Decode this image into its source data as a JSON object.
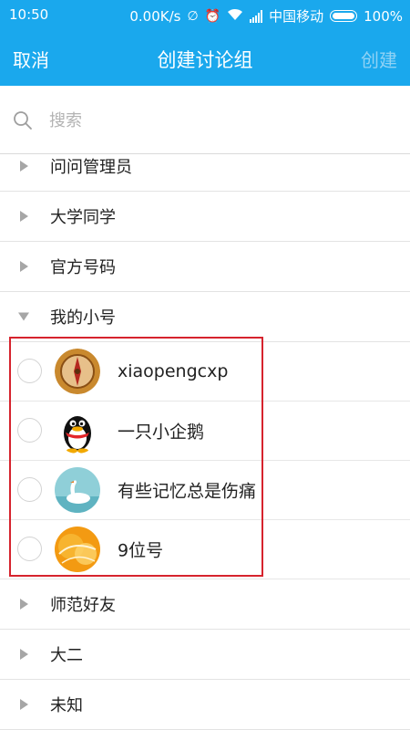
{
  "status_bar": {
    "time": "10:50",
    "speed": "0.00K/s",
    "carrier": "中国移动",
    "battery": "100%"
  },
  "title_bar": {
    "cancel_label": "取消",
    "title": "创建讨论组",
    "create_label": "创建",
    "create_disabled_color": "#8fd2f5",
    "bar_color": "#1aa8ed"
  },
  "search": {
    "placeholder": "搜索",
    "value": ""
  },
  "groups": [
    {
      "label": "问问管理员",
      "expanded": false
    },
    {
      "label": "大学同学",
      "expanded": false
    },
    {
      "label": "官方号码",
      "expanded": false
    },
    {
      "label": "我的小号",
      "expanded": true,
      "members": [
        {
          "name": "xiaopengcxp",
          "avatar": "compass-avatar",
          "checked": false
        },
        {
          "name": "一只小企鹅",
          "avatar": "penguin-avatar",
          "checked": false
        },
        {
          "name": "有些记忆总是伤痛",
          "avatar": "swan-avatar",
          "checked": false
        },
        {
          "name": "9位号",
          "avatar": "orange-pattern-avatar",
          "checked": false
        }
      ]
    },
    {
      "label": "师范好友",
      "expanded": false
    },
    {
      "label": "大二",
      "expanded": false
    },
    {
      "label": "未知",
      "expanded": false
    }
  ],
  "highlight_color": "#d6232d"
}
